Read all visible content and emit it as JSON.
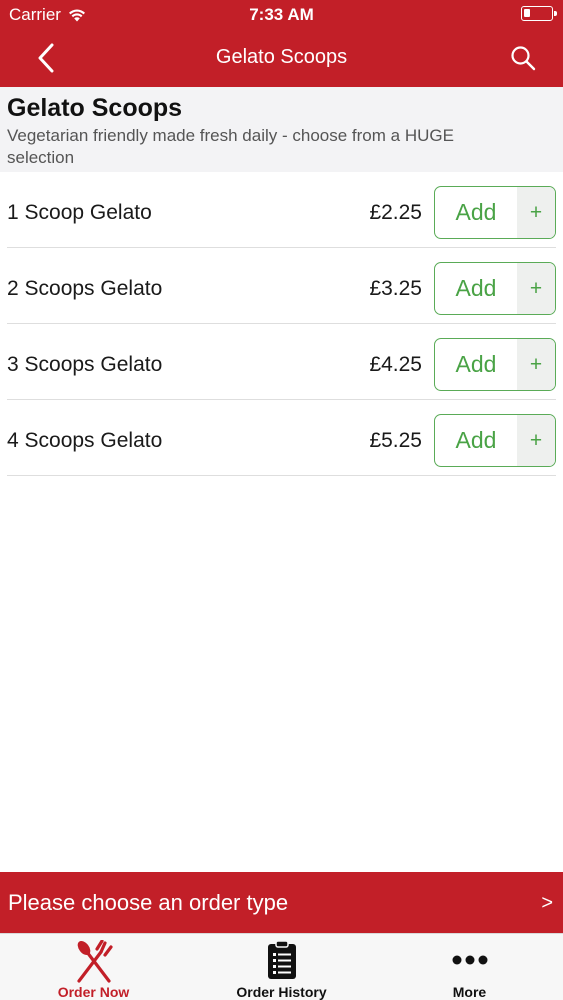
{
  "status_bar": {
    "carrier": "Carrier",
    "time": "7:33 AM"
  },
  "nav": {
    "title": "Gelato Scoops"
  },
  "category": {
    "title": "Gelato Scoops",
    "description": "Vegetarian friendly made fresh daily - choose from a HUGE selection"
  },
  "items": [
    {
      "name": "1 Scoop Gelato",
      "price": "£2.25",
      "add_label": "Add",
      "plus": "+"
    },
    {
      "name": "2 Scoops Gelato",
      "price": "£3.25",
      "add_label": "Add",
      "plus": "+"
    },
    {
      "name": "3 Scoops Gelato",
      "price": "£4.25",
      "add_label": "Add",
      "plus": "+"
    },
    {
      "name": "4 Scoops Gelato",
      "price": "£5.25",
      "add_label": "Add",
      "plus": "+"
    }
  ],
  "order_bar": {
    "text": "Please choose an order type",
    "arrow": ">"
  },
  "tabs": [
    {
      "label": "Order Now",
      "icon": "fork-knife-icon",
      "active": true
    },
    {
      "label": "Order History",
      "icon": "clipboard-list-icon",
      "active": false
    },
    {
      "label": "More",
      "icon": "more-dots-icon",
      "active": false
    }
  ],
  "colors": {
    "brand_red": "#c21f28",
    "add_green": "#4aa346",
    "tab_active": "#c21f28",
    "tab_inactive": "#111111"
  }
}
